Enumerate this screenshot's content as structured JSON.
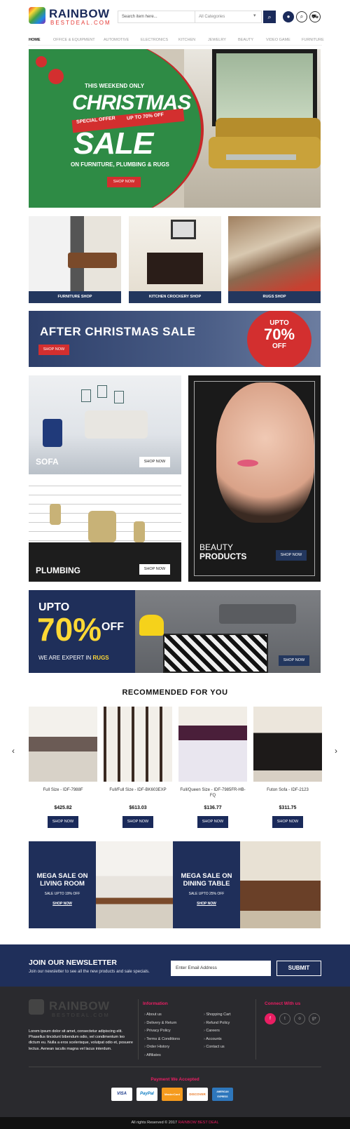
{
  "brand": {
    "name": "RAINBOW",
    "tagline": "BESTDEAL.COM"
  },
  "search": {
    "placeholder": "Search item here...",
    "category": "All Categories",
    "button_icon": "search-icon"
  },
  "header_icons": [
    "user-icon",
    "search-icon",
    "cart-icon"
  ],
  "nav": [
    "HOME",
    "OFFICE & EQUIPMENT",
    "AUTOMOTIVE",
    "ELECTRONICS",
    "KITCHEN",
    "JEWELRY",
    "BEAUTY",
    "VIDEO GAME",
    "FURNITURE"
  ],
  "hero": {
    "line1": "THIS WEEKEND ONLY",
    "line2": "CHRISTMAS",
    "ribbon_left": "SPECIAL OFFER",
    "ribbon_right": "UP TO 70% OFF",
    "line3": "SALE",
    "subtitle": "ON FURNITURE, PLUMBING & RUGS",
    "button": "SHOP NOW"
  },
  "shops": [
    {
      "label": "FURNITURE SHOP"
    },
    {
      "label": "KITCHEN CROCKERY SHOP"
    },
    {
      "label": "RUGS SHOP"
    }
  ],
  "after_sale": {
    "title": "AFTER CHRISTMAS SALE",
    "button": "SHOP NOW",
    "circle_top": "UPTO",
    "circle_big": "70%",
    "circle_bottom": "OFF"
  },
  "sofa": {
    "label": "SOFA",
    "button": "SHOP NOW"
  },
  "plumbing": {
    "label": "PLUMBING",
    "button": "SHOP NOW"
  },
  "beauty": {
    "line1": "BEAUTY",
    "line2": "PRODUCTS",
    "button": "SHOP NOW"
  },
  "rugs_banner": {
    "upto": "UPTO",
    "percent": "70%",
    "off": "OFF",
    "tag_pre": "WE ARE EXPERT IN",
    "tag_strong": "RUGS",
    "button": "SHOP NOW"
  },
  "recommended": {
    "title": "RECOMMENDED FOR YOU",
    "products": [
      {
        "name": "Full Size - IDF-7988F",
        "price": "$425.82",
        "button": "SHOP NOW"
      },
      {
        "name": "Full/Full Size - IDF-BK603EXP",
        "price": "$613.03",
        "button": "SHOP NOW"
      },
      {
        "name": "Full/Queen Size - IDF-7985FR-HB-FQ",
        "price": "$136.77",
        "button": "SHOP NOW"
      },
      {
        "name": "Futon Sofa - IDF-2123",
        "price": "$311.75",
        "button": "SHOP NOW"
      }
    ]
  },
  "mega": [
    {
      "title": "MEGA SALE ON LIVING ROOM",
      "sub": "SALE UPTO 19% OFF",
      "button": "SHOP NOW"
    },
    {
      "title": "MEGA SALE ON DINING TABLE",
      "sub": "SALE UPTO 25% OFF",
      "button": "SHOP NOW"
    }
  ],
  "newsletter": {
    "title": "JOIN OUR NEWSLETTER",
    "subtitle": "Join our newsletter to see all the new products and sale specials.",
    "placeholder": "Enter Email Address",
    "button": "SUBMIT"
  },
  "footer": {
    "about": "Lorem ipsum dolor sit amet, consectetur adipiscing elit. Phasellus tincidunt bibendum odio, vel condimentum leo dictum eu. Nulla a eros scelerisque, volutpat odio et, posuere lectus. Aenean iaculis magna vel lacus interdum.",
    "info_title": "Information",
    "links_col1": [
      "About us",
      "Delivery & Return",
      "Privacy Policy",
      "Terms & Conditions",
      "Order History",
      "Affiliates"
    ],
    "links_col2": [
      "Shopping Cart",
      "Refund Policy",
      "Careers",
      "Accounts",
      "Contact us"
    ],
    "connect_title": "Connect With us",
    "social": [
      "f",
      "t",
      "o",
      "g+"
    ],
    "payment_title": "Payment We Accepted",
    "payments": [
      "VISA",
      "PayPal",
      "MasterCard",
      "DISCOVER",
      "AMERICAN EXPRESS"
    ],
    "copyright_pre": "All rights Reserved © 2017",
    "copyright_brand": "RAINBOW BEST DEAL"
  },
  "colors": {
    "navy": "#1f2f5a",
    "red": "#d32f2f",
    "pink": "#e91e63",
    "footer": "#2a2a2e"
  }
}
